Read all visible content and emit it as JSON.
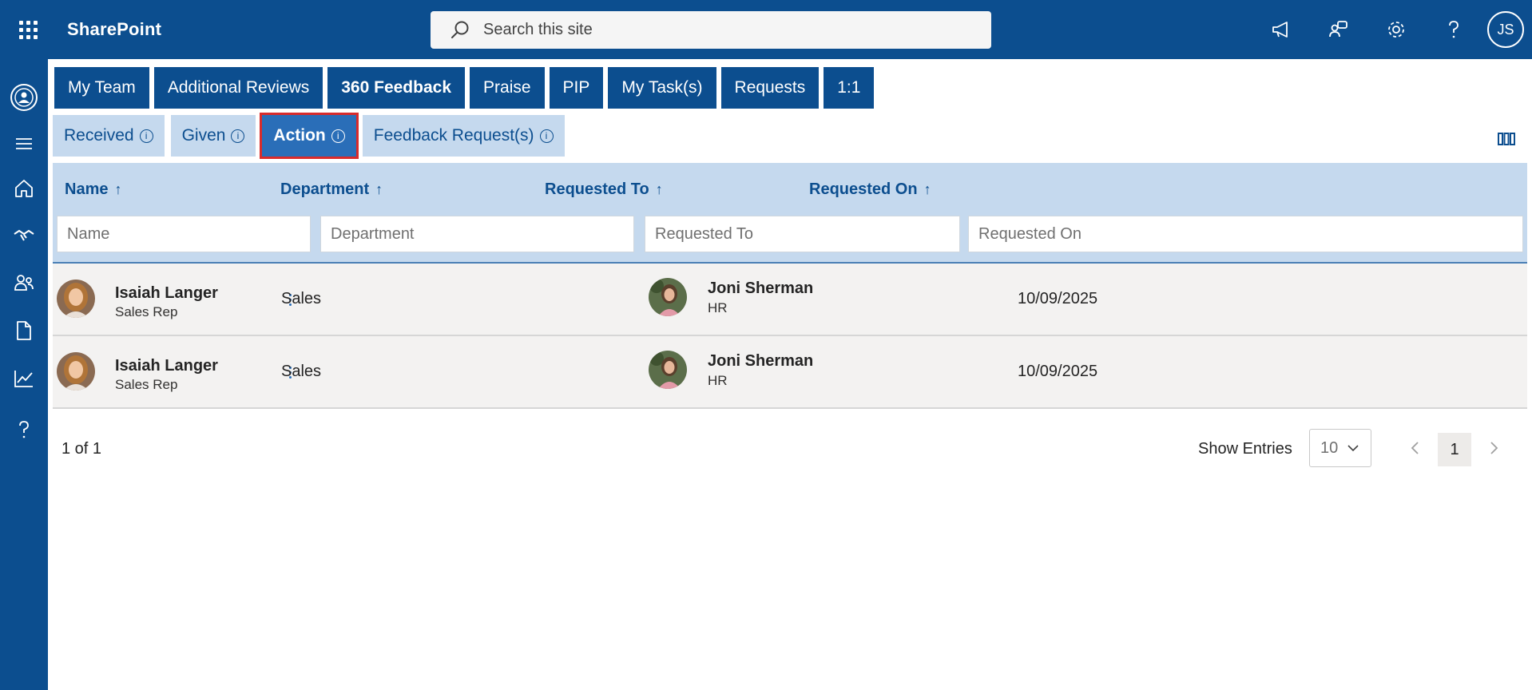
{
  "app": {
    "title": "SharePoint"
  },
  "search": {
    "placeholder": "Search this site"
  },
  "user": {
    "initials": "JS"
  },
  "top_icons": [
    "megaphone-icon",
    "people-chat-icon",
    "gear-icon",
    "help-icon"
  ],
  "rail_icons": [
    "app-logo-icon",
    "hamburger-icon",
    "home-icon",
    "handshake-icon",
    "people-icon",
    "document-icon",
    "chart-icon",
    "help-icon"
  ],
  "tabs": [
    {
      "label": "My Team",
      "bold": false
    },
    {
      "label": "Additional Reviews",
      "bold": false
    },
    {
      "label": "360 Feedback",
      "bold": true
    },
    {
      "label": "Praise",
      "bold": false
    },
    {
      "label": "PIP",
      "bold": false
    },
    {
      "label": "My Task(s)",
      "bold": false
    },
    {
      "label": "Requests",
      "bold": false
    },
    {
      "label": "1:1",
      "bold": false
    }
  ],
  "subtabs": [
    {
      "label": "Received",
      "active": false
    },
    {
      "label": "Given",
      "active": false
    },
    {
      "label": "Action",
      "active": true
    },
    {
      "label": "Feedback Request(s)",
      "active": false
    }
  ],
  "table": {
    "headers": [
      "Name",
      "Department",
      "Requested To",
      "Requested On"
    ],
    "sort_glyph": "↑",
    "filters": [
      "Name",
      "Department",
      "Requested To",
      "Requested On"
    ],
    "rows": [
      {
        "name": "Isaiah Langer",
        "title": "Sales Rep",
        "department": "Sales",
        "requested_to": "Joni Sherman",
        "requested_to_dept": "HR",
        "requested_on": "10/09/2025"
      },
      {
        "name": "Isaiah Langer",
        "title": "Sales Rep",
        "department": "Sales",
        "requested_to": "Joni Sherman",
        "requested_to_dept": "HR",
        "requested_on": "10/09/2025"
      }
    ]
  },
  "pager": {
    "summary": "1 of 1",
    "show_entries_label": "Show Entries",
    "entries_value": "10",
    "current_page": "1"
  },
  "colors": {
    "brand": "#0c4e8f",
    "header_light": "#c5d9ee",
    "active_tab": "#2a6eb8",
    "highlight": "#d92b2b"
  }
}
